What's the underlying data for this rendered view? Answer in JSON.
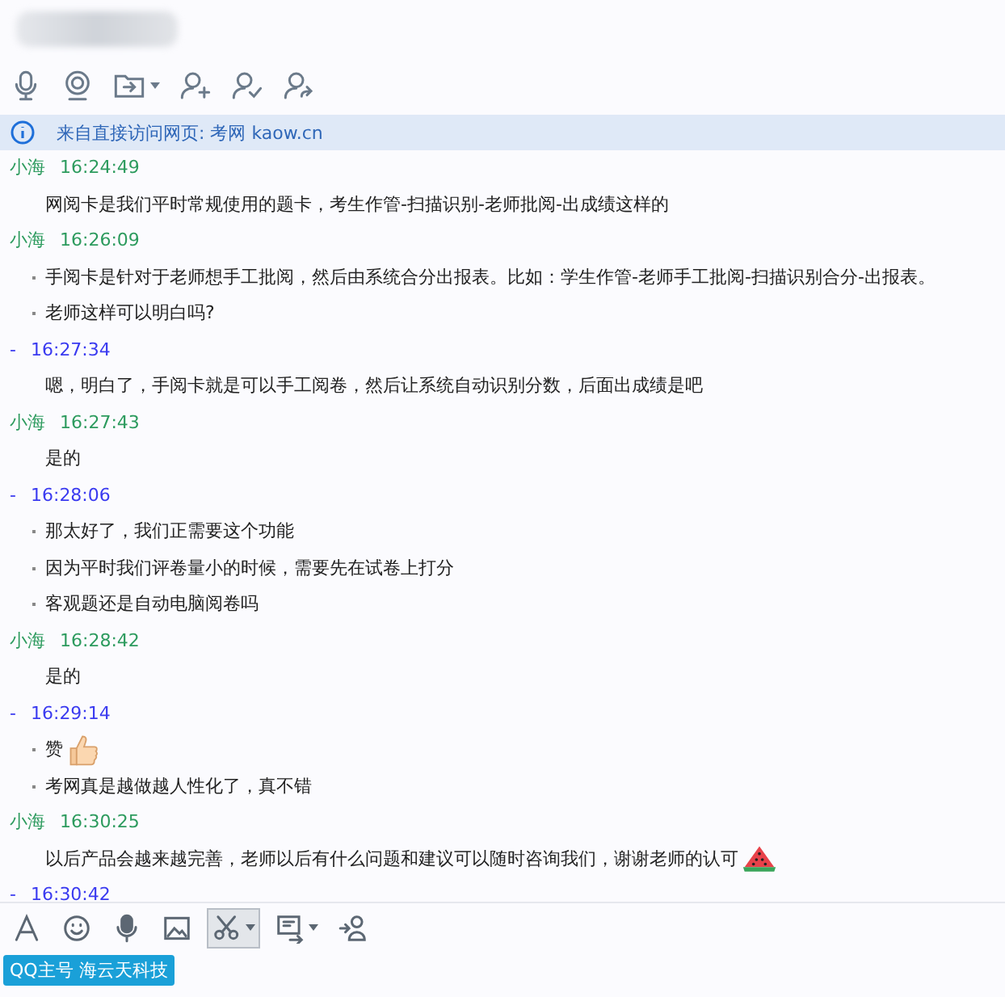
{
  "top_toolbar": [
    {
      "kind": "mic",
      "caret": false
    },
    {
      "kind": "webcam",
      "caret": false
    },
    {
      "kind": "folder",
      "caret": true
    },
    {
      "kind": "person_add",
      "caret": false
    },
    {
      "kind": "person_check",
      "caret": false
    },
    {
      "kind": "person_share",
      "caret": false
    }
  ],
  "banner": {
    "text": "来自直接访问网页: 考网 kaow.cn"
  },
  "messages": [
    {
      "sender": "小海",
      "self": false,
      "time": "16:24:49",
      "lines": [
        {
          "text": "网阅卡是我们平时常规使用的题卡，考生作管-扫描识别-老师批阅-出成绩这样的",
          "bullet": false
        }
      ]
    },
    {
      "sender": "小海",
      "self": false,
      "time": "16:26:09",
      "lines": [
        {
          "text": "手阅卡是针对于老师想手工批阅，然后由系统合分出报表。比如：学生作管-老师手工批阅-扫描识别合分-出报表。",
          "bullet": true
        },
        {
          "text": "老师这样可以明白吗?",
          "bullet": true
        }
      ]
    },
    {
      "sender": "-",
      "self": true,
      "time": "16:27:34",
      "lines": [
        {
          "text": "嗯，明白了，手阅卡就是可以手工阅卷，然后让系统自动识别分数，后面出成绩是吧",
          "bullet": false
        }
      ]
    },
    {
      "sender": "小海",
      "self": false,
      "time": "16:27:43",
      "lines": [
        {
          "text": "是的",
          "bullet": false
        }
      ]
    },
    {
      "sender": "-",
      "self": true,
      "time": "16:28:06",
      "lines": [
        {
          "text": "那太好了，我们正需要这个功能",
          "bullet": true
        },
        {
          "text": "因为平时我们评卷量小的时候，需要先在试卷上打分",
          "bullet": true
        },
        {
          "text": "客观题还是自动电脑阅卷吗",
          "bullet": true
        }
      ]
    },
    {
      "sender": "小海",
      "self": false,
      "time": "16:28:42",
      "lines": [
        {
          "text": "是的",
          "bullet": false
        }
      ]
    },
    {
      "sender": "-",
      "self": true,
      "time": "16:29:14",
      "lines": [
        {
          "text": "赞",
          "bullet": true,
          "kind": "thumbs_up"
        },
        {
          "text": "考网真是越做越人性化了，真不错",
          "bullet": true,
          "kind": "plain"
        }
      ]
    },
    {
      "sender": "小海",
      "self": false,
      "time": "16:30:25",
      "lines": [
        {
          "text": "以后产品会越来越完善，老师以后有什么问题和建议可以随时咨询我们，谢谢老师的认可",
          "bullet": false,
          "kind": "watermelon"
        }
      ]
    },
    {
      "sender": "-",
      "self": true,
      "time": "16:30:42"
    }
  ],
  "bottom_toolbar": [
    {
      "kind": "font",
      "caret": false,
      "selected": false
    },
    {
      "kind": "emoji",
      "caret": false,
      "selected": false
    },
    {
      "kind": "mic",
      "caret": false,
      "selected": false
    },
    {
      "kind": "image",
      "caret": false,
      "selected": false
    },
    {
      "kind": "scissors",
      "caret": true,
      "selected": true
    },
    {
      "kind": "screen",
      "caret": true,
      "selected": false
    },
    {
      "kind": "person_share",
      "caret": false,
      "selected": false
    }
  ],
  "account_badge": {
    "text": "QQ主号 海云天科技"
  }
}
